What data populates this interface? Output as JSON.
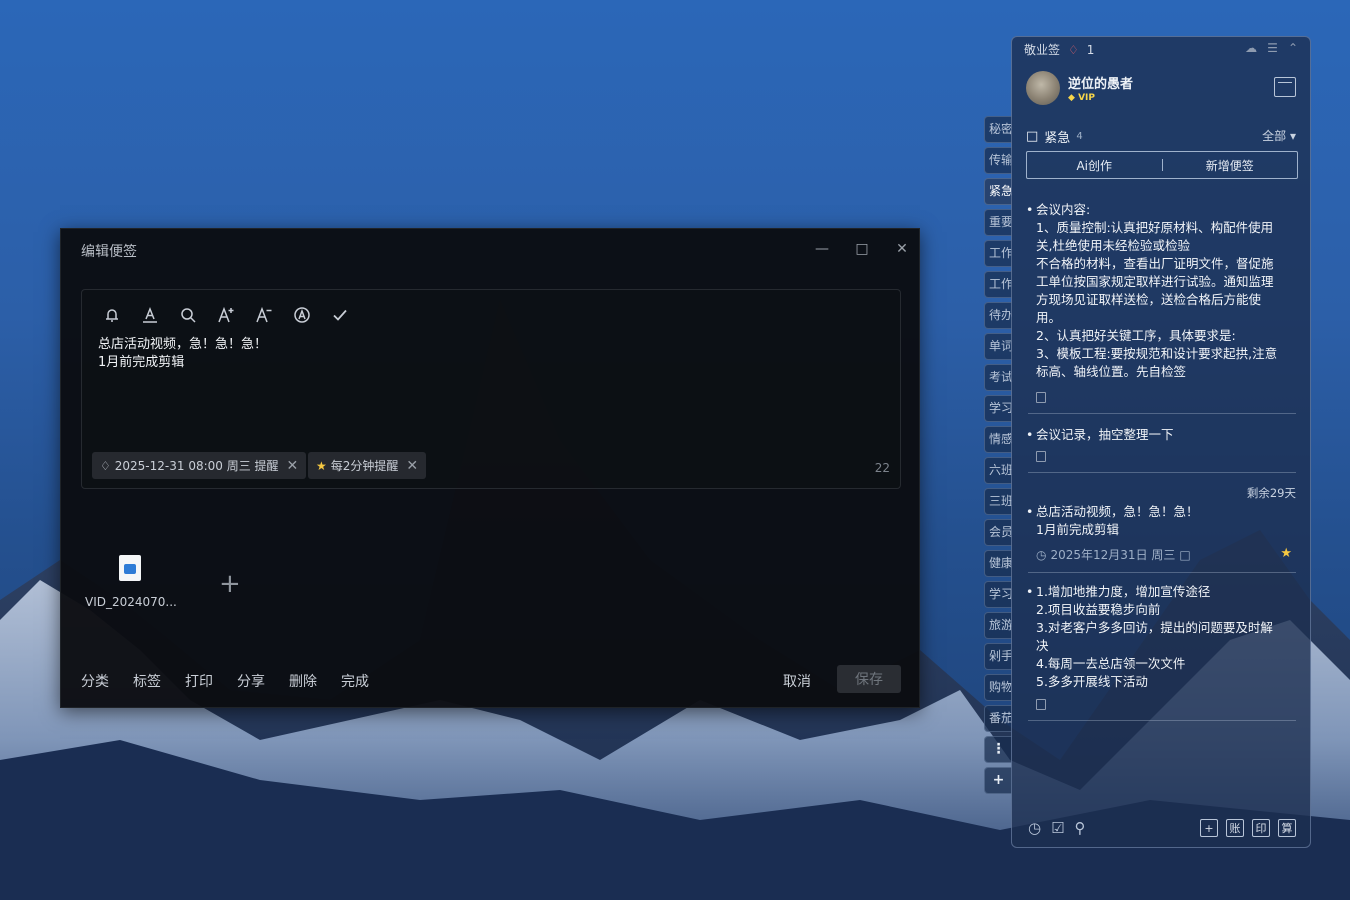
{
  "editor": {
    "title": "编辑便签",
    "content_lines": [
      "总店活动视频，急！急！急！",
      "1月前完成剪辑"
    ],
    "reminder_chip": "2025-12-31 08:00 周三 提醒",
    "repeat_chip": "每2分钟提醒",
    "char_count": "22",
    "attachment_name": "VID_2024070...",
    "footer_actions": [
      "分类",
      "标签",
      "打印",
      "分享",
      "删除",
      "完成"
    ],
    "cancel_label": "取消",
    "save_label": "保存",
    "toolbar_icons": [
      "bell-icon",
      "font-color-icon",
      "search-icon",
      "font-increase-icon",
      "font-decrease-icon",
      "text-style-icon",
      "check-icon"
    ]
  },
  "side_tabs": [
    "秘密",
    "传输",
    "紧急",
    "重要",
    "工作",
    "工作",
    "待办",
    "单词",
    "考试",
    "学习",
    "情感",
    "六班",
    "三班",
    "会员",
    "健康",
    "学习",
    "旅游",
    "剁手",
    "购物",
    "番茄"
  ],
  "side_tabs_active": "紧急",
  "panel": {
    "app_name": "敬业签",
    "bell_count": "1",
    "user_name": "逆位的愚者",
    "vip_label": "VIP",
    "category": "紧急",
    "category_count": "4",
    "filter_label": "全部",
    "ai_label": "Ai创作",
    "new_label": "新增便签",
    "notes": [
      {
        "lines": [
          "会议内容:",
          "1、质量控制:认真把好原材料、构配件使用",
          "关,杜绝使用未经检验或检验",
          "不合格的材料，查看出厂证明文件，督促施",
          "工单位按国家规定取样进行试验。通知监理",
          "方现场见证取样送检，送检合格后方能使",
          "用。",
          "2、认真把好关键工序，具体要求是:",
          "3、模板工程:要按规范和设计要求起拱,注意",
          "标高、轴线位置。先自检签"
        ]
      },
      {
        "lines": [
          "会议记录，抽空整理一下"
        ]
      },
      {
        "lines": [
          "总店活动视频，急！急！急！",
          "1月前完成剪辑"
        ],
        "remaining": "剩余29天",
        "date": "2025年12月31日 周三"
      },
      {
        "lines": [
          "1.增加地推力度，增加宣传途径",
          "2.项目收益要稳步向前",
          "3.对老客户多多回访，提出的问题要及时解",
          "决",
          "4.每周一去总店领一次文件",
          "5.多多开展线下活动"
        ]
      }
    ],
    "bottom_tools": [
      "账",
      "印",
      "算"
    ]
  }
}
